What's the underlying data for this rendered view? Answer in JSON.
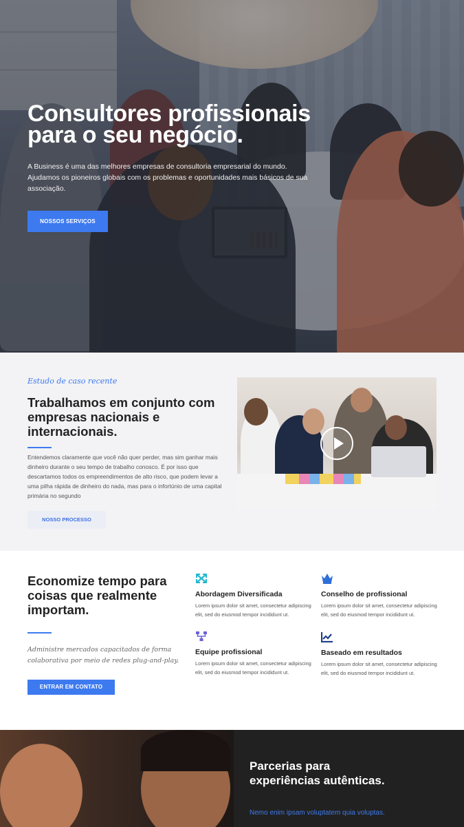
{
  "colors": {
    "accent": "#3d7af0",
    "dark_section": "#212121",
    "light_section": "#f3f3f5"
  },
  "hero": {
    "title": "Consultores profissionais para o seu negócio.",
    "description": "A Business é uma das melhores empresas de consultoria empresarial do mundo. Ajudamos os pioneiros globais com os problemas e oportunidades mais básicos de sua associação.",
    "button_label": "NOSSOS SERVIÇOS"
  },
  "case_study": {
    "eyebrow": "Estudo de caso recente",
    "title": "Trabalhamos em conjunto com empresas nacionais e internacionais.",
    "text": "Entendemos claramente que você não quer perder, mas sim ganhar mais dinheiro durante o seu tempo de trabalho conosco. É por isso que descartamos todos os empreendimentos de alto risco, que podem levar a uma pilha rápida de dinheiro do nada, mas para o infortúnio de uma capital primária no segundo",
    "button_label": "NOSSO PROCESSO",
    "video_icon": "play-icon"
  },
  "features": {
    "title": "Economize tempo para coisas que realmente importam.",
    "subtitle": "Administre mercados capacitados de forma colaborativa por meio de redes plug-and-play.",
    "button_label": "ENTRAR EM CONTATO",
    "items": [
      {
        "icon": "arrows-expand-icon",
        "name": "Abordagem Diversificada",
        "text": "Lorem ipsum dolor sit amet, consectetur adipiscing elit, sed do eiusmod tempor incididunt ut."
      },
      {
        "icon": "crown-icon",
        "name": "Conselho de profissional",
        "text": "Lorem ipsum dolor sit amet, consectetur adipiscing elit, sed do eiusmod tempor incididunt ut."
      },
      {
        "icon": "network-icon",
        "name": "Equipe profissional",
        "text": "Lorem ipsum dolor sit amet, consectetur adipiscing elit, sed do eiusmod tempor incididunt ut."
      },
      {
        "icon": "chart-line-icon",
        "name": "Baseado em resultados",
        "text": "Lorem ipsum dolor sit amet, consectetur adipiscing elit, sed do eiusmod tempor incididunt ut."
      }
    ]
  },
  "partner": {
    "title": "Parcerias para experiências autênticas.",
    "subtitle": "Nemo enim ipsam voluptatem quia voluptas."
  }
}
